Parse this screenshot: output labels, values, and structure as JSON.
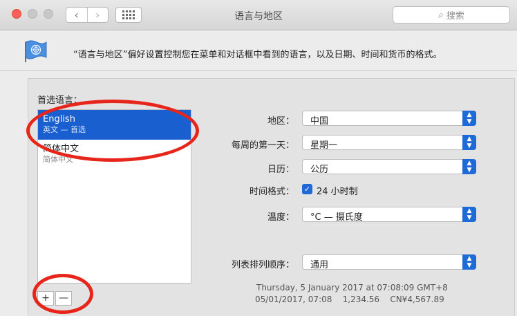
{
  "window": {
    "title": "语言与地区",
    "search_placeholder": "搜索"
  },
  "toolbar": {
    "back_glyph": "‹",
    "forward_glyph": "›"
  },
  "header": {
    "description": "“语言与地区”偏好设置控制您在菜单和对话框中看到的语言，以及日期、时间和货币的格式。"
  },
  "languages": {
    "label": "首选语言：",
    "items": [
      {
        "name": "English",
        "sub": "英文 — 首选"
      },
      {
        "name": "简体中文",
        "sub": "简体中文"
      }
    ],
    "add_label": "+",
    "remove_label": "—"
  },
  "settings": {
    "region_label": "地区：",
    "region_value": "中国",
    "first_day_label": "每周的第一天：",
    "first_day_value": "星期一",
    "calendar_label": "日历：",
    "calendar_value": "公历",
    "time_format_label": "时间格式：",
    "time_format_checkbox": "24 小时制",
    "time_format_checked": true,
    "temperature_label": "温度：",
    "temperature_value": "°C — 摄氏度",
    "sort_label": "列表排列顺序：",
    "sort_value": "通用"
  },
  "sample": {
    "line1": "Thursday, 5 January 2017 at 07:08:09 GMT+8",
    "line2": "05/01/2017, 07:08    1,234.56    CN¥4,567.89"
  },
  "colors": {
    "accent": "#1f6ad6",
    "selection": "#1a5fd0",
    "annotation": "#e8251b"
  }
}
